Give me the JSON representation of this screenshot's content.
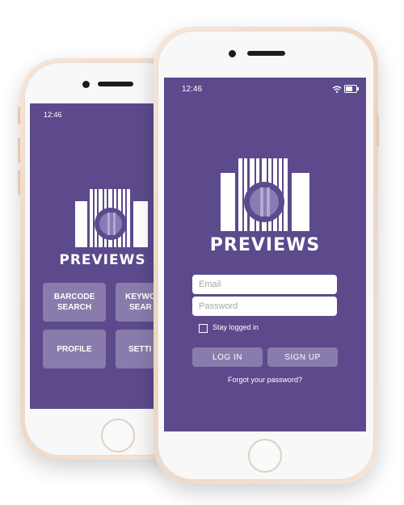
{
  "back_phone": {
    "status_time": "12:46",
    "logo_text": "PREVIEWS",
    "menu": [
      {
        "label": "BARCODE\nSEARCH"
      },
      {
        "label": "KEYWO\nSEAR"
      },
      {
        "label": "PROFILE"
      },
      {
        "label": "SETTI"
      }
    ]
  },
  "front_phone": {
    "status_time": "12:46",
    "logo_text": "PREVIEWS",
    "login": {
      "email_placeholder": "Email",
      "password_placeholder": "Password",
      "stay_logged_in": "Stay logged in",
      "login_button": "LOG IN",
      "signup_button": "SIGN UP",
      "forgot_password": "Forgot your password?"
    }
  },
  "colors": {
    "brand_purple": "#5c4a8c",
    "phone_frame": "#ecd3c1"
  }
}
